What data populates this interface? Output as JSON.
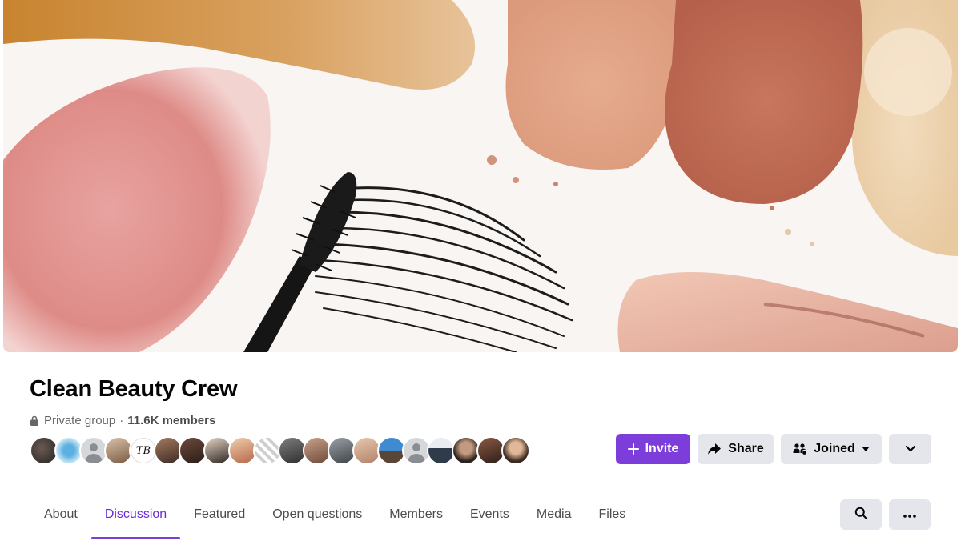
{
  "group": {
    "name": "Clean Beauty Crew",
    "privacy": "Private group",
    "separator": "·",
    "members": "11.6K members"
  },
  "actions": {
    "invite": "Invite",
    "share": "Share",
    "joined": "Joined"
  },
  "avatars": {
    "tb_text": "TB"
  },
  "tabs": [
    "About",
    "Discussion",
    "Featured",
    "Open questions",
    "Members",
    "Events",
    "Media",
    "Files"
  ],
  "active_tab": "Discussion",
  "colors": {
    "accent": "#7d3ddb",
    "button_gray": "#e4e6eb",
    "text_secondary": "#65676b"
  },
  "icons": {
    "lock": "lock-icon",
    "plus": "plus-icon",
    "share": "share-arrow-icon",
    "joined": "people-icon",
    "chevron": "chevron-down-icon",
    "search": "search-icon",
    "more": "more-dots-icon"
  }
}
